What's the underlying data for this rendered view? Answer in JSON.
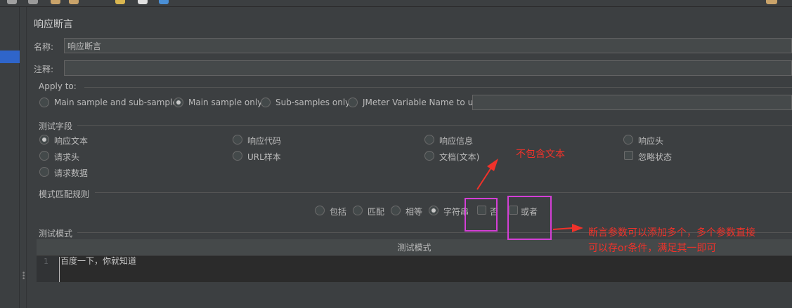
{
  "panel": {
    "title": "响应断言",
    "name_label": "名称:",
    "name_value": "响应断言",
    "comment_label": "注释:",
    "comment_value": ""
  },
  "apply_to": {
    "legend": "Apply to:",
    "options": [
      "Main sample and sub-samples",
      "Main sample only",
      "Sub-samples only",
      "JMeter Variable Name to use"
    ],
    "selected": "Main sample only",
    "variable_value": ""
  },
  "test_field": {
    "legend": "测试字段",
    "options": [
      "响应文本",
      "响应代码",
      "响应信息",
      "响应头",
      "请求头",
      "URL样本",
      "文档(文本)",
      "请求数据"
    ],
    "selected": "响应文本",
    "ignore_status_label": "忽略状态"
  },
  "pattern_rules": {
    "legend": "模式匹配规则",
    "options": [
      "包括",
      "匹配",
      "相等",
      "字符串"
    ],
    "selected": "字符串",
    "not_label": "否",
    "or_label": "或者"
  },
  "test_pattern": {
    "legend": "测试模式",
    "column_header": "测试模式",
    "line_number": "1",
    "line_text": "百度一下，你就知道"
  },
  "annotations": {
    "not_contains": "不包含文本",
    "or_note_line1": "断言参数可以添加多个，多个参数直接",
    "or_note_line2": "可以存or条件，满足其一即可"
  },
  "colors": {
    "background": "#3c3f41",
    "highlight_box": "#d43fd6",
    "annotation_red": "#f0322a"
  }
}
